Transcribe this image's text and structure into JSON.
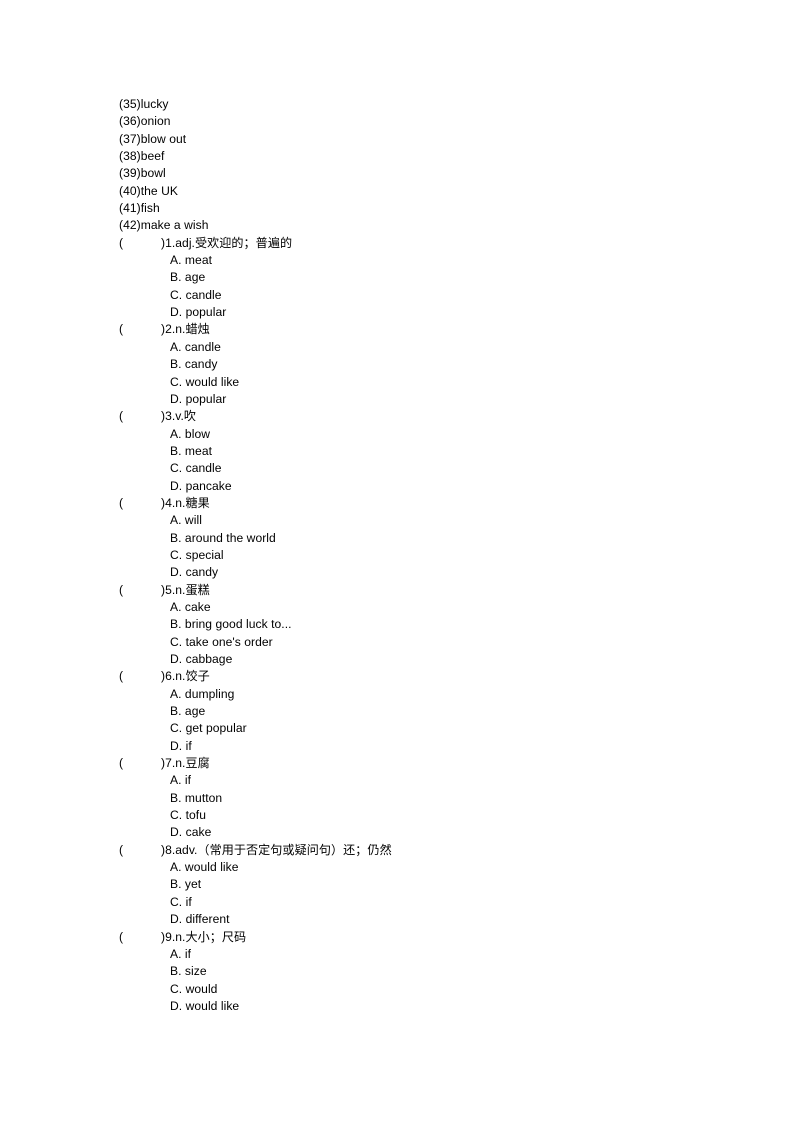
{
  "document": {
    "word_list": [
      "(35)lucky",
      "(36)onion",
      "(37)blow out",
      "(38)beef",
      "(39)bowl",
      "(40)the UK",
      "(41)fish",
      "(42)make a wish"
    ],
    "answer_blank_open": "(",
    "answer_blank_close": ")",
    "questions": [
      {
        "stem": ")1.adj.受欢迎的；普遍的",
        "options": [
          "A. meat",
          "B. age",
          "C. candle",
          "D. popular"
        ]
      },
      {
        "stem": ")2.n.蜡烛",
        "options": [
          "A. candle",
          "B. candy",
          "C. would like",
          "D. popular"
        ]
      },
      {
        "stem": ")3.v.吹",
        "options": [
          "A. blow",
          "B. meat",
          "C. candle",
          "D. pancake"
        ]
      },
      {
        "stem": ")4.n.糖果",
        "options": [
          "A. will",
          "B. around the world",
          "C. special",
          "D. candy"
        ]
      },
      {
        "stem": ")5.n.蛋糕",
        "options": [
          "A. cake",
          "B. bring good luck to...",
          "C. take one's order",
          "D. cabbage"
        ]
      },
      {
        "stem": ")6.n.饺子",
        "options": [
          "A. dumpling",
          "B. age",
          "C. get popular",
          "D. if"
        ]
      },
      {
        "stem": ")7.n.豆腐",
        "options": [
          "A. if",
          "B. mutton",
          "C. tofu",
          "D. cake"
        ]
      },
      {
        "stem": ")8.adv.（常用于否定句或疑问句）还；仍然",
        "options": [
          "A. would like",
          "B. yet",
          "C. if",
          "D. different"
        ]
      },
      {
        "stem": ")9.n.大小；尺码",
        "options": [
          "A. if",
          "B. size",
          "C. would",
          "D. would like"
        ]
      }
    ]
  }
}
